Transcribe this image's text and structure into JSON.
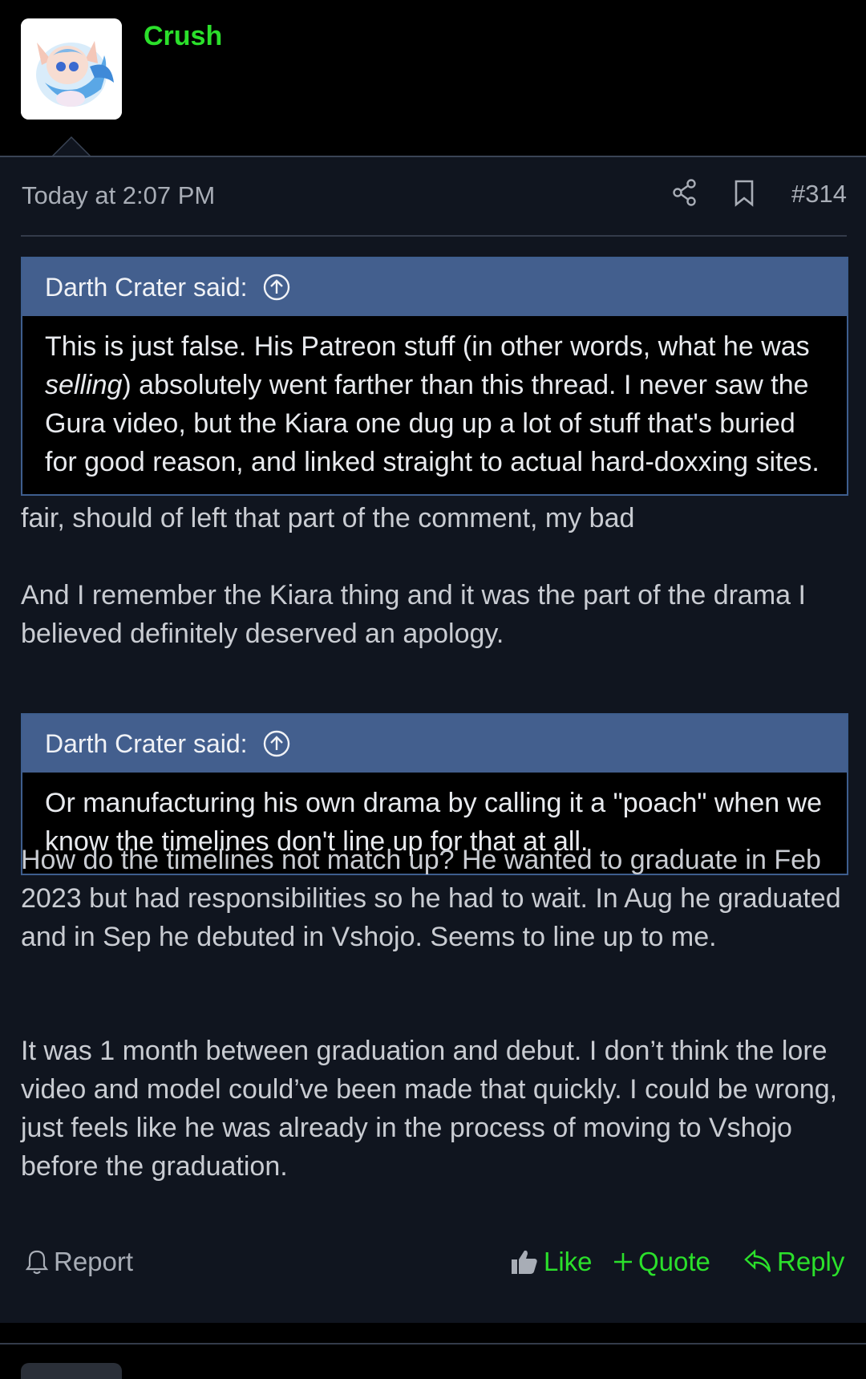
{
  "user": {
    "name": "Crush"
  },
  "post": {
    "timestamp": "Today at 2:07 PM",
    "number": "#314",
    "icons": {
      "share": "share-icon",
      "bookmark": "bookmark-icon"
    }
  },
  "quotes": [
    {
      "author": "Darth Crater said:",
      "text_before": "This is just false. His Patreon stuff (in other words, what he was ",
      "text_em": "selling",
      "text_after": ") absolutely went farther than this thread. I never saw the Gura video, but the Kiara one dug up a lot of stuff that's buried for good reason, and linked straight to actual hard-doxxing sites."
    },
    {
      "author": "Darth Crater said:",
      "text": "Or manufacturing his own drama by calling it a \"poach\" when we know the timelines don't line up for that at all."
    }
  ],
  "replies": {
    "r1_p1": "fair, should of left that part of the comment, my bad",
    "r1_p2": "And I remember the Kiara thing and it was the part of the drama I believed definitely deserved an apology.",
    "r2_p1": "How do the timelines not match up? He wanted to graduate in Feb 2023 but had responsibilities so he had to wait. In Aug he graduated and in Sep he debuted in Vshojo. Seems to line up to me.",
    "r2_p2": "It was 1 month between graduation and debut. I don’t think the lore video and model could’ve been made that quickly. I could be wrong, just feels like he was already in the process of moving to Vshojo before the graduation."
  },
  "actions": {
    "report": "Report",
    "like": "Like",
    "quote": "Quote",
    "reply": "Reply"
  },
  "colors": {
    "accent_green": "#2be02b",
    "quote_header": "#435f8e",
    "post_bg": "#10151f"
  }
}
